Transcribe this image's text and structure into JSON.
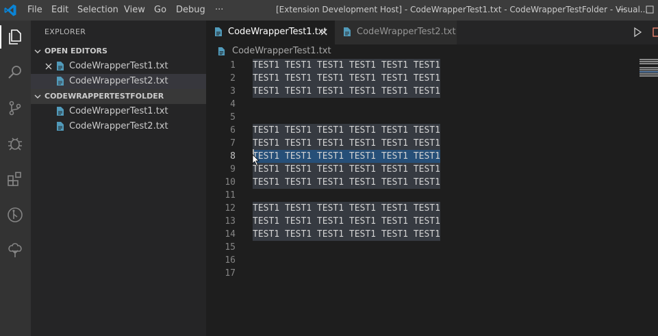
{
  "menu": [
    "File",
    "Edit",
    "Selection",
    "View",
    "Go",
    "Debug",
    "···"
  ],
  "window_title": "[Extension Development Host] - CodeWrapperTest1.txt - CodeWrapperTestFolder - Visual...",
  "explorer": {
    "title": "EXPLORER",
    "open_editors_header": "OPEN EDITORS",
    "open_editors": [
      {
        "name": "CodeWrapperTest1.txt"
      },
      {
        "name": "CodeWrapperTest2.txt"
      }
    ],
    "folder_header": "CODEWRAPPERTESTFOLDER",
    "folder_files": [
      {
        "name": "CodeWrapperTest1.txt"
      },
      {
        "name": "CodeWrapperTest2.txt"
      }
    ]
  },
  "tabs": [
    {
      "label": "CodeWrapperTest1.txt"
    },
    {
      "label": "CodeWrapperTest2.txt"
    }
  ],
  "breadcrumb": "CodeWrapperTest1.txt",
  "editor": {
    "line_numbers": [
      "1",
      "2",
      "3",
      "4",
      "5",
      "6",
      "7",
      "8",
      "9",
      "10",
      "11",
      "12",
      "13",
      "14",
      "15",
      "16",
      "17"
    ],
    "lines": [
      "TEST1 TEST1 TEST1 TEST1 TEST1 TEST1",
      "TEST1 TEST1 TEST1 TEST1 TEST1 TEST1",
      "TEST1 TEST1 TEST1 TEST1 TEST1 TEST1",
      "",
      "",
      "TEST1 TEST1 TEST1 TEST1 TEST1 TEST1",
      "TEST1 TEST1 TEST1 TEST1 TEST1 TEST1",
      "TEST1 TEST1 TEST1 TEST1 TEST1 TEST1",
      "TEST1 TEST1 TEST1 TEST1 TEST1 TEST1",
      "TEST1 TEST1 TEST1 TEST1 TEST1 TEST1",
      "",
      "TEST1 TEST1 TEST1 TEST1 TEST1 TEST1",
      "TEST1 TEST1 TEST1 TEST1 TEST1 TEST1",
      "TEST1 TEST1 TEST1 TEST1 TEST1 TEST1",
      "",
      "",
      ""
    ],
    "selected_line": "8"
  },
  "colors": {
    "accent": "#0078d4",
    "file_icon": "#519aba",
    "selection": "#264f78",
    "wrap_highlight": "#363a41"
  },
  "icons": {
    "activity_bar": [
      "explorer-icon",
      "search-icon",
      "source-control-icon",
      "debug-icon",
      "extensions-icon",
      "remote-icon",
      "tree-icon"
    ],
    "title_bar": [
      "vscode-logo-icon",
      "minimize-icon",
      "maximize-icon"
    ],
    "tab_bar": [
      "run-icon",
      "split-editor-icon"
    ]
  }
}
